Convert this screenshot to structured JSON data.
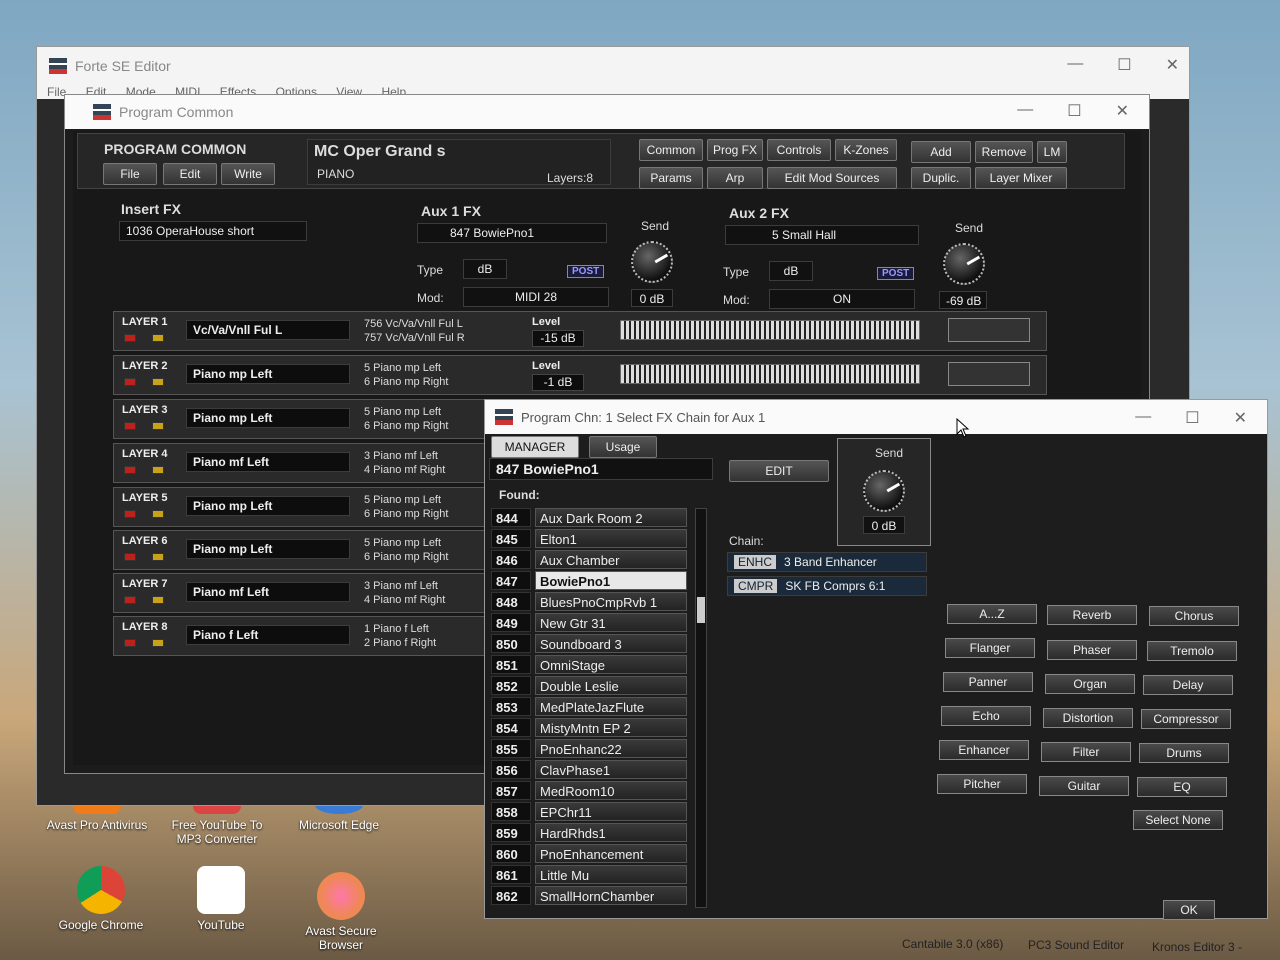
{
  "desktop": {
    "icons": [
      {
        "label": "Avast Pro Antivirus"
      },
      {
        "label": "Free YouTube To MP3 Converter"
      },
      {
        "label": "Microsoft Edge"
      },
      {
        "label": "Google Chrome"
      },
      {
        "label": "YouTube"
      },
      {
        "label": "Avast Secure Browser"
      }
    ],
    "taskbar": [
      "Cantabile 3.0 (x86)",
      "PC3 Sound Editor",
      "Kronos Editor 3 -"
    ]
  },
  "forte": {
    "title": "Forte SE Editor",
    "menu": [
      "File",
      "Edit",
      "Mode",
      "MIDI",
      "Effects",
      "Options",
      "View",
      "Help"
    ]
  },
  "program_common": {
    "window_title": "Program Common",
    "section_label": "PROGRAM COMMON",
    "file_buttons": [
      "File",
      "Edit",
      "Write"
    ],
    "program_name": "MC Oper Grand s",
    "category": "PIANO",
    "layers_text": "Layers:8",
    "tabs_row1": [
      "Common",
      "Prog FX",
      "Controls",
      "K-Zones"
    ],
    "tabs_row2": [
      "Params",
      "Arp",
      "Edit Mod Sources"
    ],
    "actions_row1": [
      "Add",
      "Remove",
      "LM"
    ],
    "actions_row2": [
      "Duplic.",
      "Layer Mixer"
    ],
    "insert_fx": {
      "label": "Insert FX",
      "value": "1036  OperaHouse short"
    },
    "aux1": {
      "label": "Aux 1 FX",
      "value": "847  BowiePno1",
      "type_label": "Type",
      "type": "dB",
      "post": "POST",
      "mod_label": "Mod:",
      "mod": "MIDI 28",
      "send_label": "Send",
      "send": "0 dB"
    },
    "aux2": {
      "label": "Aux 2 FX",
      "value": "5  Small Hall",
      "type_label": "Type",
      "type": "dB",
      "post": "POST",
      "mod_label": "Mod:",
      "mod": "ON",
      "send_label": "Send",
      "send": "-69 dB"
    },
    "layers": [
      {
        "label": "LAYER 1",
        "name": "Vc/Va/Vnll Ful L",
        "k1": "756 Vc/Va/Vnll Ful L",
        "k2": "757 Vc/Va/Vnll Ful R",
        "level_label": "Level",
        "level": "-15 dB"
      },
      {
        "label": "LAYER 2",
        "name": "Piano mp Left",
        "k1": "5 Piano mp Left",
        "k2": "6 Piano mp Right",
        "level_label": "Level",
        "level": "-1 dB"
      },
      {
        "label": "LAYER 3",
        "name": "Piano mp Left",
        "k1": "5 Piano mp Left",
        "k2": "6 Piano mp Right"
      },
      {
        "label": "LAYER 4",
        "name": "Piano mf Left",
        "k1": "3 Piano mf Left",
        "k2": "4 Piano mf Right"
      },
      {
        "label": "LAYER 5",
        "name": "Piano mp Left",
        "k1": "5 Piano mp Left",
        "k2": "6 Piano mp Right"
      },
      {
        "label": "LAYER 6",
        "name": "Piano mp Left",
        "k1": "5 Piano mp Left",
        "k2": "6 Piano mp Right"
      },
      {
        "label": "LAYER 7",
        "name": "Piano mf Left",
        "k1": "3 Piano mf Left",
        "k2": "4 Piano mf Right"
      },
      {
        "label": "LAYER 8",
        "name": "Piano f Left",
        "k1": "1 Piano f Left",
        "k2": "2 Piano f Right"
      }
    ]
  },
  "dialog": {
    "title": "Program Chn: 1  Select FX Chain for Aux 1",
    "tabs": [
      "MANAGER",
      "Usage"
    ],
    "current": "847  BowiePno1",
    "edit": "EDIT",
    "send_label": "Send",
    "send": "0 dB",
    "found_label": "Found:",
    "chain_label": "Chain:",
    "chain": [
      {
        "tag": "ENHC",
        "name": "3 Band Enhancer"
      },
      {
        "tag": "CMPR",
        "name": "SK FB Comprs 6:1"
      }
    ],
    "list": [
      {
        "num": "844",
        "name": "Aux Dark Room 2"
      },
      {
        "num": "845",
        "name": "Elton1"
      },
      {
        "num": "846",
        "name": "Aux Chamber"
      },
      {
        "num": "847",
        "name": "BowiePno1"
      },
      {
        "num": "848",
        "name": "BluesPnoCmpRvb 1"
      },
      {
        "num": "849",
        "name": "New Gtr 31"
      },
      {
        "num": "850",
        "name": "Soundboard 3"
      },
      {
        "num": "851",
        "name": "OmniStage"
      },
      {
        "num": "852",
        "name": "Double Leslie"
      },
      {
        "num": "853",
        "name": "MedPlateJazFlute"
      },
      {
        "num": "854",
        "name": "MistyMntn EP 2"
      },
      {
        "num": "855",
        "name": "PnoEnhanc22"
      },
      {
        "num": "856",
        "name": "ClavPhase1"
      },
      {
        "num": "857",
        "name": "MedRoom10"
      },
      {
        "num": "858",
        "name": "EPChr11"
      },
      {
        "num": "859",
        "name": "HardRhds1"
      },
      {
        "num": "860",
        "name": "PnoEnhancement"
      },
      {
        "num": "861",
        "name": "Little Mu"
      },
      {
        "num": "862",
        "name": "SmallHornChamber"
      }
    ],
    "fx_buttons": [
      [
        "A...Z",
        "Reverb",
        "Chorus"
      ],
      [
        "Flanger",
        "Phaser",
        "Tremolo"
      ],
      [
        "Panner",
        "Organ",
        "Delay"
      ],
      [
        "Echo",
        "Distortion",
        "Compressor"
      ],
      [
        "Enhancer",
        "Filter",
        "Drums"
      ],
      [
        "Pitcher",
        "Guitar",
        "EQ"
      ]
    ],
    "select_none": "Select None",
    "ok": "OK"
  },
  "colors": {
    "led_red": "#c0201c",
    "led_yellow": "#c9a21a",
    "accent": "#99f"
  }
}
